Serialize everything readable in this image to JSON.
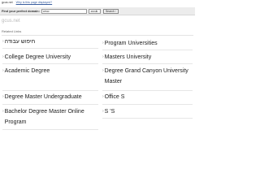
{
  "topbar": {
    "domain": "gcus.net",
    "link": "Why is this page displayed?"
  },
  "search": {
    "label": "Find your perfect domain:",
    "value": "www.",
    "tld": ".co.uk",
    "button": "Search ›"
  },
  "site": {
    "title": "gcus.net",
    "related_label": "Related Links"
  },
  "links": {
    "left": [
      {
        "text": "חיפוש עבודה"
      },
      {
        "text": "College Degree University"
      },
      {
        "text": "Academic Degree"
      },
      {
        "text": "Degree Master Undergraduate"
      },
      {
        "text": "Bachelor Degree Master Online Program"
      }
    ],
    "right": [
      {
        "text": "Program Universities"
      },
      {
        "text": "Masters University"
      },
      {
        "text": "Degree Grand Canyon University Master"
      },
      {
        "text": "Office S"
      },
      {
        "text": "S 'S"
      }
    ]
  },
  "colors": {
    "link_text": "#222222",
    "arrow": "#888888",
    "search_bg": "#ececec",
    "title": "#bbbbbb"
  }
}
